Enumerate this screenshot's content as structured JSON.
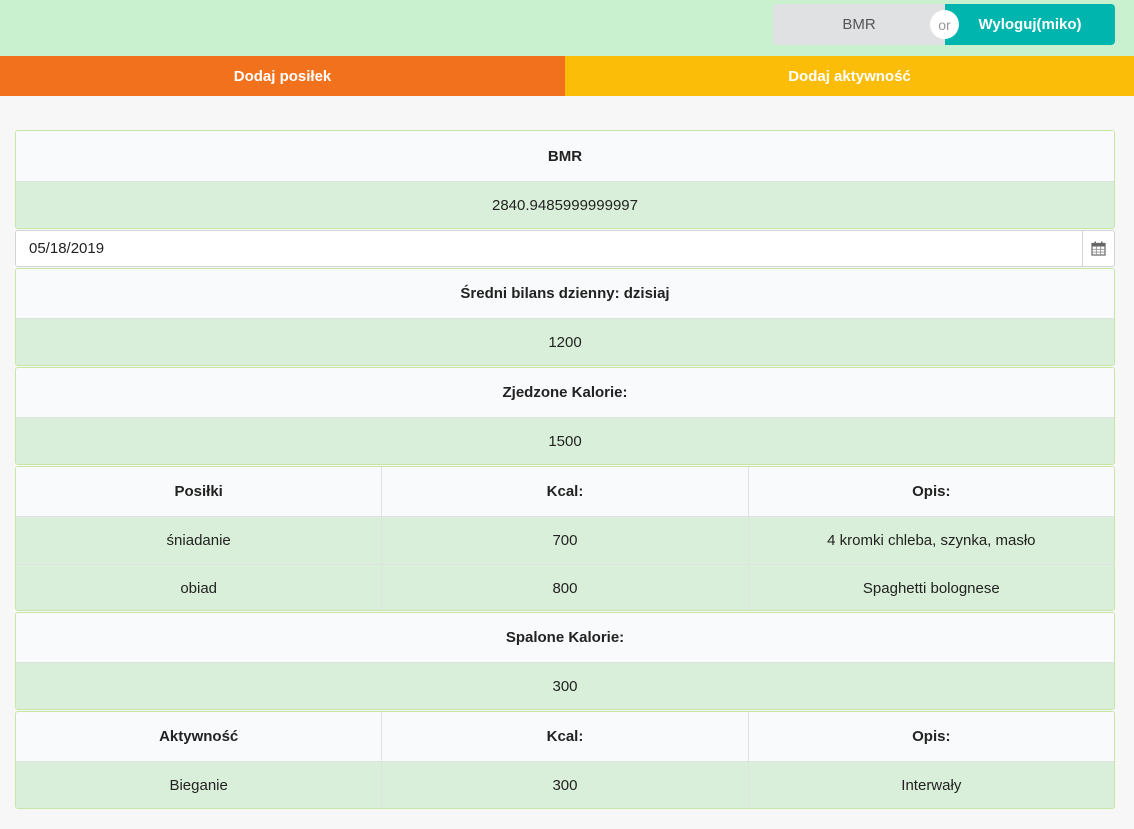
{
  "header": {
    "bmr_button": "BMR",
    "or_label": "or",
    "logout_button": "Wyloguj(miko)"
  },
  "tabs": {
    "add_meal": "Dodaj posiłek",
    "add_activity": "Dodaj aktywność"
  },
  "bmr": {
    "title": "BMR",
    "value": "2840.9485999999997"
  },
  "date": {
    "value": "05/18/2019"
  },
  "balance": {
    "title": "Średni bilans dzienny: dzisiaj",
    "value": "1200"
  },
  "eaten": {
    "title": "Zjedzone Kalorie:",
    "value": "1500"
  },
  "meals": {
    "headers": [
      "Posiłki",
      "Kcal:",
      "Opis:"
    ],
    "rows": [
      [
        "śniadanie",
        "700",
        "4 kromki chleba, szynka, masło"
      ],
      [
        "obiad",
        "800",
        "Spaghetti bolognese"
      ]
    ]
  },
  "burned": {
    "title": "Spalone Kalorie:",
    "value": "300"
  },
  "activities": {
    "headers": [
      "Aktywność",
      "Kcal:",
      "Opis:"
    ],
    "rows": [
      [
        "Bieganie",
        "300",
        "Interwały"
      ]
    ]
  },
  "icons": {
    "calendar": "calendar-icon"
  },
  "colors": {
    "topbar": "#c9f0cf",
    "meal_tab": "#f2711c",
    "activity_tab": "#fbbd08",
    "logout": "#00b5ad",
    "value_row": "#d9efd9"
  }
}
